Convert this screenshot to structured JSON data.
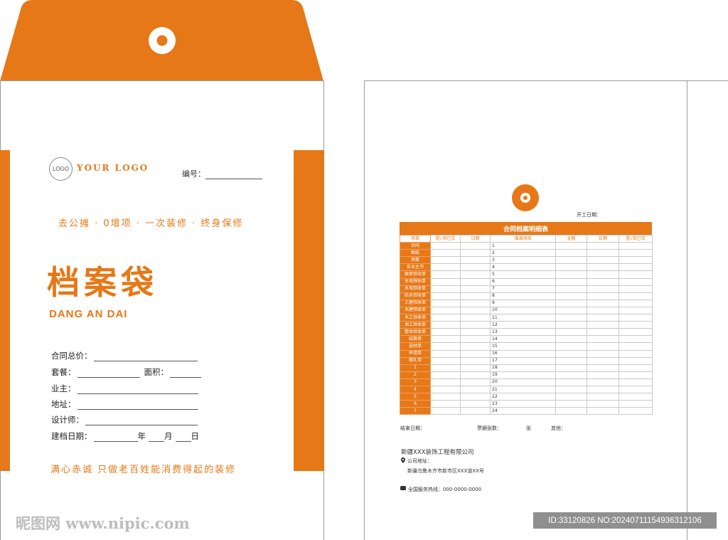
{
  "left": {
    "logo_circle": "LOGO",
    "logo_text": "YOUR LOGO",
    "serial_label": "编号：",
    "slogan": "去公摊 · 0增项 · 一次装修 · 终身保修",
    "title_cn": "档案袋",
    "title_en": "DANG AN DAI",
    "fields": {
      "contract_total": "合同总价：",
      "package": "套餐：",
      "area": "面积：",
      "owner": "业主：",
      "address": "地址：",
      "designer": "设计师：",
      "date": "建档日期：",
      "year": "年",
      "month": "月",
      "day": "日"
    },
    "bottom_slogan": "满心赤诚  只做老百姓能消费得起的装修"
  },
  "right": {
    "start_date": "开工日期：",
    "table_title": "合同档案明细表",
    "headers": [
      "项目",
      "是√否已交",
      "日期",
      "增减项目",
      "金额",
      "日期",
      "是√否已交"
    ],
    "rows": [
      {
        "item": "合同",
        "num": "1"
      },
      {
        "item": "图纸",
        "num": "2"
      },
      {
        "item": "预算",
        "num": "3"
      },
      {
        "item": "告业主书",
        "num": "4"
      },
      {
        "item": "原房验收单",
        "num": "5"
      },
      {
        "item": "水电预估单",
        "num": "6"
      },
      {
        "item": "水电验收单",
        "num": "7"
      },
      {
        "item": "防水验收单",
        "num": "8"
      },
      {
        "item": "土建验收单",
        "num": "9"
      },
      {
        "item": "木建验收单",
        "num": "10"
      },
      {
        "item": "木工验收单",
        "num": "11"
      },
      {
        "item": "油工验收单",
        "num": "12"
      },
      {
        "item": "整体验收单",
        "num": "13"
      },
      {
        "item": "结算单",
        "num": "14"
      },
      {
        "item": "选材单",
        "num": "15"
      },
      {
        "item": "申请单",
        "num": "16"
      },
      {
        "item": "赠礼单",
        "num": "17"
      },
      {
        "item": "1",
        "num": "18"
      },
      {
        "item": "2",
        "num": "19"
      },
      {
        "item": "3",
        "num": "20"
      },
      {
        "item": "4",
        "num": "21"
      },
      {
        "item": "5",
        "num": "22"
      },
      {
        "item": "6",
        "num": "23"
      },
      {
        "item": "7",
        "num": "24"
      }
    ],
    "end_date": "结束日期：",
    "receipts": "票据张数：",
    "sheets": "张",
    "other": "其他：",
    "company": "新疆XXX装饰工程有限公司",
    "address_label": "公司地址：",
    "address": "新疆乌鲁木齐市新市区XXX道XX号",
    "hotline": "全国服务热线：000-0000-0000"
  },
  "watermark": "昵图网 www.nipic.com",
  "image_id": "ID:33120826 NO:20240711154936312106",
  "colors": {
    "accent": "#e67817"
  }
}
